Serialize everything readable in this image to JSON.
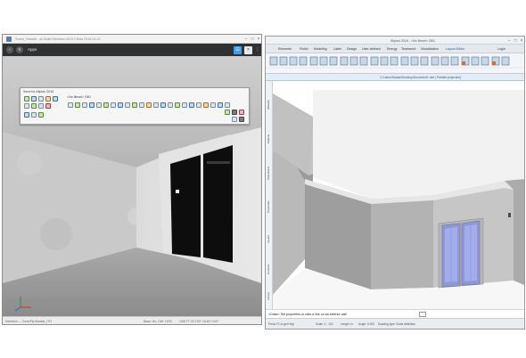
{
  "left_window": {
    "title": "Scene_Hasselt - an Build Windows 2019.2 Beta 2018-02-22",
    "toolbar": {
      "apps_label": "Apps",
      "back_icon": "back-arrow-icon",
      "menu_icon": "menu-icon",
      "close_icon": "close-icon"
    },
    "send_panel": {
      "title": "Send for Allplan 2018",
      "document_label": "<No filesel> DB1"
    },
    "status": {
      "selection": "Selection:  -- Zone/Fly Module_ITO",
      "nav": "Base: 0m, Cell: 1978",
      "coords": "10/8.TT 2S.TS0\" 16.60\" 0.00\"",
      "accent": "#2f3133"
    }
  },
  "right_window": {
    "title": "Allplan 2018  -  <No filesel> DB1",
    "menu_tabs": [
      "Elements",
      "Finish",
      "Modeling",
      "Label",
      "Design",
      "User-defined",
      "Energy",
      "Teamwork",
      "Visualization",
      "Layout Editor"
    ],
    "active_tab": "Layout Editor",
    "login_label": "Login",
    "path": "C:\\Users\\Hasael\\Desktop\\Document1 nde | Parallel projection]",
    "side_tabs": [
      "Wizards",
      "Objects",
      "Task Board",
      "Properties",
      "Layers",
      "Connect",
      "Library"
    ],
    "prompt": "<Draw> Set properties or click a line on an exterior wall",
    "status": {
      "left": "Press F1 to get Help",
      "zoom": "Scale: 1 : 100",
      "length": "Length: m",
      "angle": "Angle: 0.000",
      "drawing": "Drawing type:  Scale definition"
    }
  }
}
